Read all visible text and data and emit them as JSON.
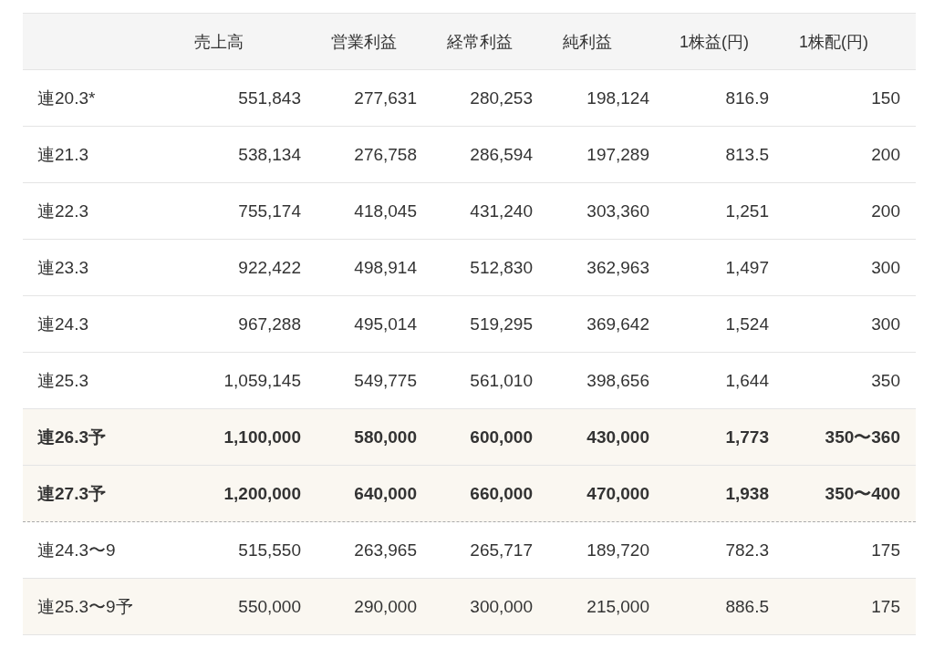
{
  "table": {
    "columns": [
      "",
      "売上高",
      "営業利益",
      "経常利益",
      "純利益",
      "1株益(円)",
      "1株配(円)"
    ],
    "rows": [
      {
        "cells": [
          "連20.3*",
          "551,843",
          "277,631",
          "280,253",
          "198,124",
          "816.9",
          "150"
        ],
        "highlighted": false,
        "bold": false,
        "dashed_bottom": false
      },
      {
        "cells": [
          "連21.3",
          "538,134",
          "276,758",
          "286,594",
          "197,289",
          "813.5",
          "200"
        ],
        "highlighted": false,
        "bold": false,
        "dashed_bottom": false
      },
      {
        "cells": [
          "連22.3",
          "755,174",
          "418,045",
          "431,240",
          "303,360",
          "1,251",
          "200"
        ],
        "highlighted": false,
        "bold": false,
        "dashed_bottom": false
      },
      {
        "cells": [
          "連23.3",
          "922,422",
          "498,914",
          "512,830",
          "362,963",
          "1,497",
          "300"
        ],
        "highlighted": false,
        "bold": false,
        "dashed_bottom": false
      },
      {
        "cells": [
          "連24.3",
          "967,288",
          "495,014",
          "519,295",
          "369,642",
          "1,524",
          "300"
        ],
        "highlighted": false,
        "bold": false,
        "dashed_bottom": false
      },
      {
        "cells": [
          "連25.3",
          "1,059,145",
          "549,775",
          "561,010",
          "398,656",
          "1,644",
          "350"
        ],
        "highlighted": false,
        "bold": false,
        "dashed_bottom": false
      },
      {
        "cells": [
          "連26.3予",
          "1,100,000",
          "580,000",
          "600,000",
          "430,000",
          "1,773",
          "350〜360"
        ],
        "highlighted": true,
        "bold": true,
        "dashed_bottom": false
      },
      {
        "cells": [
          "連27.3予",
          "1,200,000",
          "640,000",
          "660,000",
          "470,000",
          "1,938",
          "350〜400"
        ],
        "highlighted": true,
        "bold": true,
        "dashed_bottom": true
      },
      {
        "cells": [
          "連24.3〜9",
          "515,550",
          "263,965",
          "265,717",
          "189,720",
          "782.3",
          "175"
        ],
        "highlighted": false,
        "bold": false,
        "dashed_bottom": false
      },
      {
        "cells": [
          "連25.3〜9予",
          "550,000",
          "290,000",
          "300,000",
          "215,000",
          "886.5",
          "175"
        ],
        "highlighted": true,
        "bold": false,
        "dashed_bottom": false
      }
    ]
  }
}
